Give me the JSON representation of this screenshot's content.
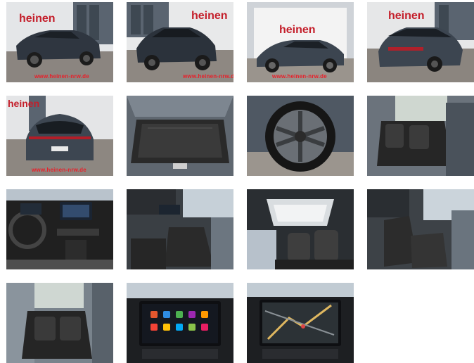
{
  "gallery": {
    "dealer_logo": "heinen",
    "watermark": "www.heinen-nrw.de",
    "items": [
      {
        "name": "photo-front-left-exterior",
        "watermark": true,
        "logo": true
      },
      {
        "name": "photo-front-exterior",
        "watermark": true,
        "logo": true
      },
      {
        "name": "photo-side-exterior",
        "watermark": true,
        "logo": true
      },
      {
        "name": "photo-rear-left-exterior",
        "watermark": false,
        "logo": true
      },
      {
        "name": "photo-rear-exterior",
        "watermark": true,
        "logo": true
      },
      {
        "name": "photo-trunk",
        "watermark": false,
        "logo": false
      },
      {
        "name": "photo-wheel",
        "watermark": false,
        "logo": false
      },
      {
        "name": "photo-rear-seats",
        "watermark": false,
        "logo": false
      },
      {
        "name": "photo-dashboard",
        "watermark": false,
        "logo": false
      },
      {
        "name": "photo-front-seats",
        "watermark": false,
        "logo": false
      },
      {
        "name": "photo-sunroof",
        "watermark": false,
        "logo": false
      },
      {
        "name": "photo-passenger-seat",
        "watermark": false,
        "logo": false
      },
      {
        "name": "photo-rear-door-seats",
        "watermark": false,
        "logo": false
      },
      {
        "name": "photo-infotainment-menu",
        "watermark": false,
        "logo": false
      },
      {
        "name": "photo-navigation-map",
        "watermark": false,
        "logo": false
      }
    ]
  }
}
